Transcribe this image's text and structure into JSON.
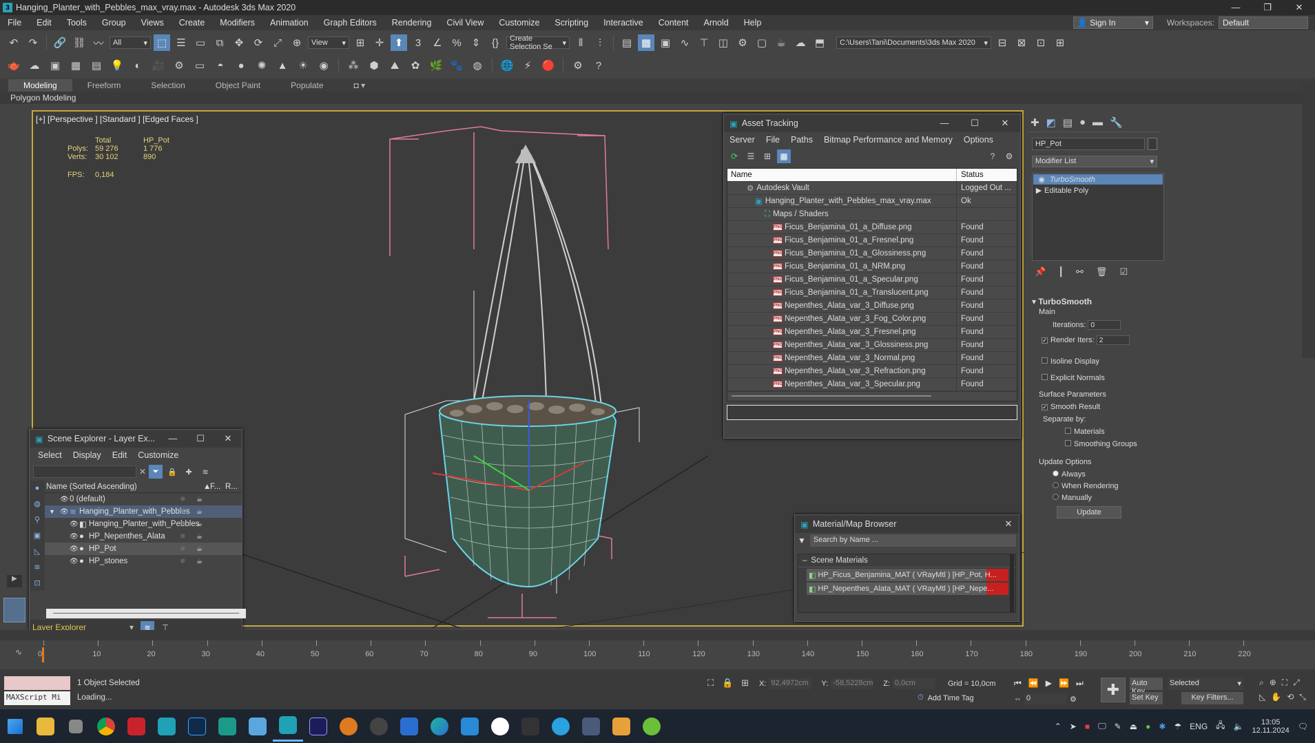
{
  "window": {
    "title": "Hanging_Planter_with_Pebbles_max_vray.max - Autodesk 3ds Max 2020",
    "min": "—",
    "max": "❐",
    "close": "✕"
  },
  "menu": [
    "File",
    "Edit",
    "Tools",
    "Group",
    "Views",
    "Create",
    "Modifiers",
    "Animation",
    "Graph Editors",
    "Rendering",
    "Civil View",
    "Customize",
    "Scripting",
    "Interactive",
    "Content",
    "Arnold",
    "Help"
  ],
  "signin": {
    "label": "Sign In",
    "workspaces_label": "Workspaces:",
    "workspace": "Default"
  },
  "toolbar": {
    "filter": "All",
    "view": "View",
    "selection_set": "Create Selection Se",
    "path": "C:\\Users\\Tani\\Documents\\3ds Max 2020"
  },
  "ribbon": {
    "tabs": [
      "Modeling",
      "Freeform",
      "Selection",
      "Object Paint",
      "Populate"
    ],
    "sub": "Polygon Modeling"
  },
  "viewport": {
    "label": "[+] [Perspective ] [Standard ] [Edged Faces ]",
    "stats": {
      "total": "Total",
      "obj": "HP_Pot",
      "polys_label": "Polys:",
      "polys_total": "59 276",
      "polys_obj": "1 776",
      "verts_label": "Verts:",
      "verts_total": "30 102",
      "verts_obj": "890",
      "fps_label": "FPS:",
      "fps": "0,184"
    }
  },
  "asset": {
    "title": "Asset Tracking",
    "menu": [
      "Server",
      "File",
      "Paths",
      "Bitmap Performance and Memory",
      "Options"
    ],
    "col_name": "Name",
    "col_status": "Status",
    "rows": [
      {
        "name": "Autodesk Vault",
        "status": "Logged Out ...",
        "level": 1
      },
      {
        "name": "Hanging_Planter_with_Pebbles_max_vray.max",
        "status": "Ok",
        "level": 2
      },
      {
        "name": "Maps / Shaders",
        "status": "",
        "level": 3
      },
      {
        "name": "Ficus_Benjamina_01_a_Diffuse.png",
        "status": "Found",
        "level": 4
      },
      {
        "name": "Ficus_Benjamina_01_a_Fresnel.png",
        "status": "Found",
        "level": 4
      },
      {
        "name": "Ficus_Benjamina_01_a_Glossiness.png",
        "status": "Found",
        "level": 4
      },
      {
        "name": "Ficus_Benjamina_01_a_NRM.png",
        "status": "Found",
        "level": 4
      },
      {
        "name": "Ficus_Benjamina_01_a_Specular.png",
        "status": "Found",
        "level": 4
      },
      {
        "name": "Ficus_Benjamina_01_a_Translucent.png",
        "status": "Found",
        "level": 4
      },
      {
        "name": "Nepenthes_Alata_var_3_Diffuse.png",
        "status": "Found",
        "level": 4
      },
      {
        "name": "Nepenthes_Alata_var_3_Fog_Color.png",
        "status": "Found",
        "level": 4
      },
      {
        "name": "Nepenthes_Alata_var_3_Fresnel.png",
        "status": "Found",
        "level": 4
      },
      {
        "name": "Nepenthes_Alata_var_3_Glossiness.png",
        "status": "Found",
        "level": 4
      },
      {
        "name": "Nepenthes_Alata_var_3_Normal.png",
        "status": "Found",
        "level": 4
      },
      {
        "name": "Nepenthes_Alata_var_3_Refraction.png",
        "status": "Found",
        "level": 4
      },
      {
        "name": "Nepenthes_Alata_var_3_Specular.png",
        "status": "Found",
        "level": 4
      }
    ]
  },
  "scene": {
    "title": "Scene Explorer - Layer Ex...",
    "menu": [
      "Select",
      "Display",
      "Edit",
      "Customize"
    ],
    "col_name": "Name (Sorted Ascending)",
    "col_f": "F...",
    "col_r": "R...",
    "rows": [
      {
        "name": "0 (default)",
        "indent": 1
      },
      {
        "name": "Hanging_Planter_with_Pebbles",
        "indent": 1
      },
      {
        "name": "Hanging_Planter_with_Pebbles",
        "indent": 2
      },
      {
        "name": "HP_Nepenthes_Alata",
        "indent": 2
      },
      {
        "name": "HP_Pot",
        "indent": 2
      },
      {
        "name": "HP_stones",
        "indent": 2
      }
    ],
    "footer": "Layer Explorer"
  },
  "matb": {
    "title": "Material/Map Browser",
    "search": "Search by Name ...",
    "section": "Scene Materials",
    "items": [
      "HP_Ficus_Benjamina_MAT  ( VRayMtl )  [HP_Pot, H...",
      "HP_Nepenthes_Alata_MAT  ( VRayMtl )  [HP_Nepe..."
    ]
  },
  "cmd": {
    "object_name": "HP_Pot",
    "modifier_list": "Modifier List",
    "stack": [
      "TurboSmooth",
      "Editable Poly"
    ],
    "rollout": "TurboSmooth",
    "main": "Main",
    "iterations_label": "Iterations:",
    "iterations": "0",
    "render_iters_label": "Render Iters:",
    "render_iters": "2",
    "isoline": "Isoline Display",
    "explicit": "Explicit Normals",
    "surface": "Surface Parameters",
    "smooth": "Smooth Result",
    "separate": "Separate by:",
    "materials": "Materials",
    "smoothing": "Smoothing Groups",
    "update_opts": "Update Options",
    "always": "Always",
    "when_rendering": "When Rendering",
    "manually": "Manually",
    "update": "Update"
  },
  "timeline": {
    "ticks": [
      "0",
      "10",
      "20",
      "30",
      "40",
      "50",
      "60",
      "70",
      "80",
      "90",
      "100",
      "110",
      "120",
      "130",
      "140",
      "150",
      "160",
      "170",
      "180",
      "190",
      "200",
      "210",
      "220"
    ]
  },
  "status": {
    "maxscript": "MAXScript Mi",
    "selected": "1 Object Selected",
    "loading": "Loading...",
    "x_label": "X:",
    "x": "92,4972cm",
    "y_label": "Y:",
    "y": "-58,5228cm",
    "z_label": "Z:",
    "z": "0,0cm",
    "grid": "Grid = 10,0cm",
    "add_time_tag": "Add Time Tag",
    "auto_key": "Auto Key",
    "set_key": "Set Key",
    "selected_dd": "Selected",
    "key_filters": "Key Filters...",
    "frame": "0"
  },
  "taskbar": {
    "lang": "ENG",
    "time": "13:05",
    "date": "12.11.2024"
  }
}
